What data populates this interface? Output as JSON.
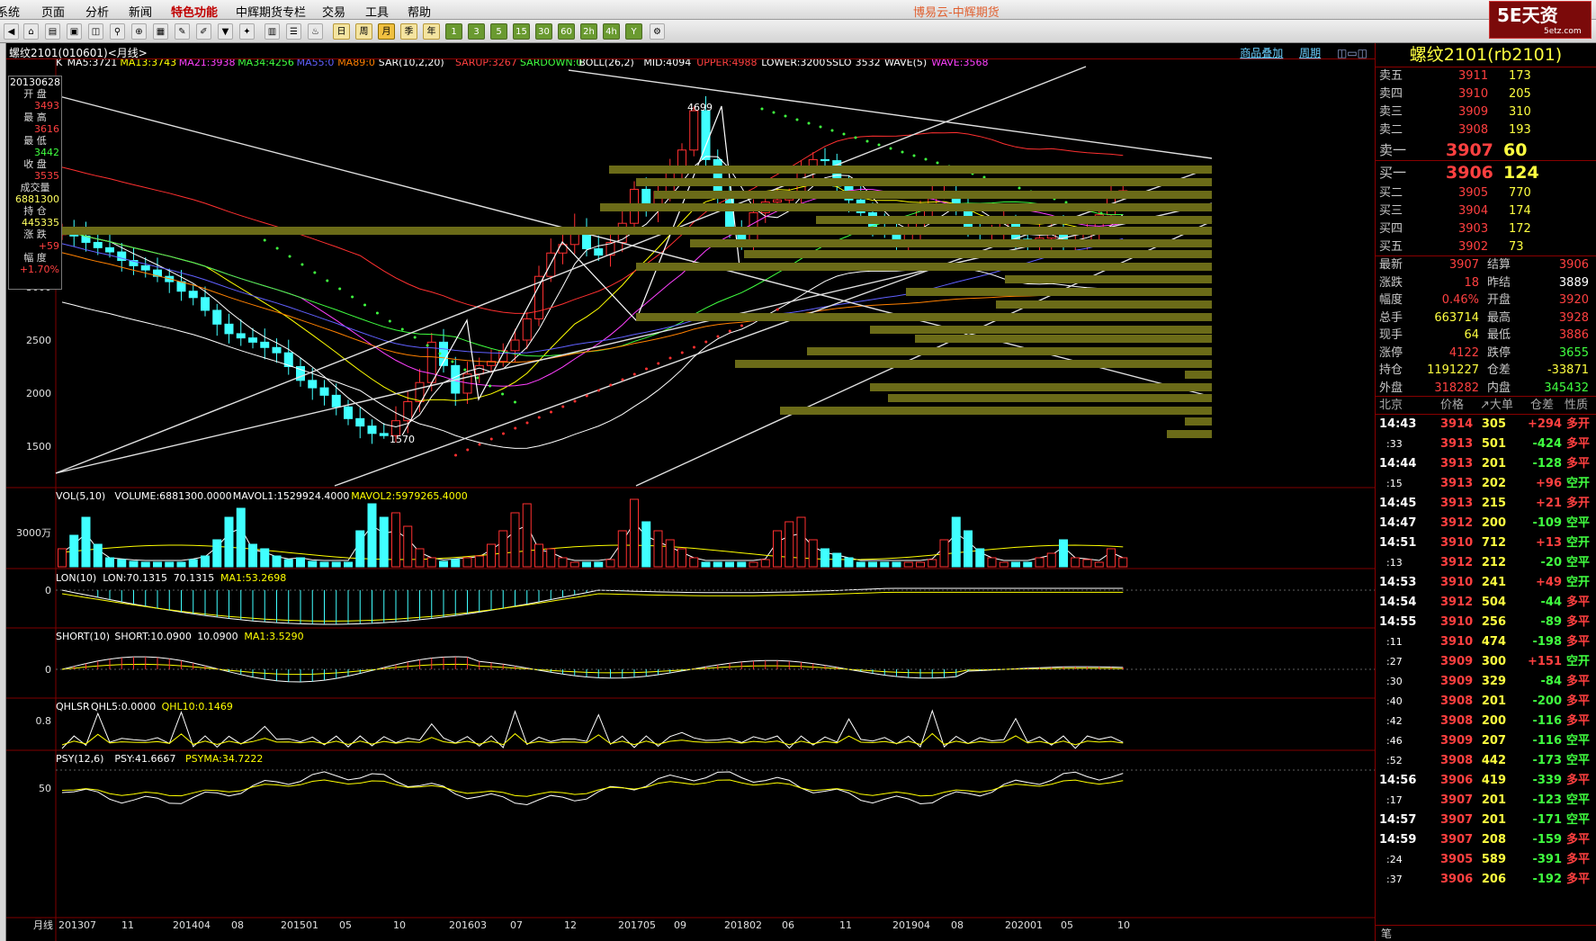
{
  "menu": {
    "items": [
      "系统",
      "页面",
      "分析",
      "新闻",
      "特色功能",
      "中辉期货专栏",
      "交易",
      "工具",
      "帮助"
    ],
    "app_title": "博易云-中辉期货"
  },
  "toolbar": {
    "period_buttons": [
      "日",
      "周",
      "月",
      "季",
      "年",
      "1",
      "3",
      "5",
      "15",
      "30",
      "60",
      "2h",
      "4h",
      "Y"
    ]
  },
  "logo": {
    "text": "5E天资",
    "url_text": "5etz.com"
  },
  "chart": {
    "title": "螺纹2101(010601)<月线>",
    "header_links": [
      "商品叠加",
      "周期"
    ],
    "main_legend": [
      {
        "text": "K",
        "color": "#ffffff"
      },
      {
        "text": "MA5:3721",
        "color": "#ffffff"
      },
      {
        "text": "MA13:3743",
        "color": "#ffff00"
      },
      {
        "text": "MA21:3938",
        "color": "#ff40ff"
      },
      {
        "text": "MA34:4256",
        "color": "#40ff40"
      },
      {
        "text": "MA55:0",
        "color": "#6060ff"
      },
      {
        "text": "MA89:0",
        "color": "#ff8000"
      },
      {
        "text": "SAR(10,2,20)",
        "color": "#ffffff"
      },
      {
        "text": "SARUP:3267",
        "color": "#ff4040"
      },
      {
        "text": "SARDOWN:0",
        "color": "#40ff40"
      },
      {
        "text": "BOLL(26,2)",
        "color": "#ffffff"
      },
      {
        "text": "MID:4094",
        "color": "#ffffff"
      },
      {
        "text": "UPPER:4988",
        "color": "#ff4040"
      },
      {
        "text": "LOWER:3200",
        "color": "#ffffff"
      },
      {
        "text": "SSLO",
        "color": "#ffffff"
      },
      {
        "text": "3532",
        "color": "#ffffff"
      },
      {
        "text": "WAVE(5)",
        "color": "#ffffff"
      },
      {
        "text": "WAVE:3568",
        "color": "#ff40ff"
      }
    ],
    "y_ticks": [
      "3000",
      "2500",
      "2000",
      "1500"
    ],
    "annotations": {
      "high": "4699",
      "low": "1570"
    },
    "infobox": {
      "date": "20130628",
      "open_label": "开 盘",
      "open": "3493",
      "high_label": "最 高",
      "high": "3616",
      "low_label": "最 低",
      "low": "3442",
      "close_label": "收 盘",
      "close": "3535",
      "vol_label": "成交量",
      "vol": "6881300",
      "oi_label": "持 仓",
      "oi": "445335",
      "chg_label": "涨 跌",
      "chg": "+59",
      "pct_label": "幅 度",
      "pct": "+1.70%"
    },
    "vol_legend": [
      {
        "text": "VOL(5,10)",
        "color": "#ffffff"
      },
      {
        "text": "VOLUME:6881300.0000",
        "color": "#ffffff"
      },
      {
        "text": "MAVOL1:1529924.4000",
        "color": "#ffffff"
      },
      {
        "text": "MAVOL2:5979265.4000",
        "color": "#ffff00"
      }
    ],
    "vol_tick": "3000万",
    "lon_legend": [
      {
        "text": "LON(10)",
        "color": "#ffffff"
      },
      {
        "text": "LON:70.1315",
        "color": "#ffffff"
      },
      {
        "text": "70.1315",
        "color": "#ffffff"
      },
      {
        "text": "MA1:53.2698",
        "color": "#ffff00"
      }
    ],
    "lon_tick": "0",
    "short_legend": [
      {
        "text": "SHORT(10)",
        "color": "#ffffff"
      },
      {
        "text": "SHORT:10.0900",
        "color": "#ffffff"
      },
      {
        "text": "10.0900",
        "color": "#ffffff"
      },
      {
        "text": "MA1:3.5290",
        "color": "#ffff00"
      }
    ],
    "short_tick": "0",
    "qhl_legend": [
      {
        "text": "QHLSR",
        "color": "#ffffff"
      },
      {
        "text": "QHL5:0.0000",
        "color": "#ffffff"
      },
      {
        "text": "QHL10:0.1469",
        "color": "#ffff00"
      }
    ],
    "qhl_tick": "0.8",
    "psy_legend": [
      {
        "text": "PSY(12,6)",
        "color": "#ffffff"
      },
      {
        "text": "PSY:41.6667",
        "color": "#ffffff"
      },
      {
        "text": "PSYMA:34.7222",
        "color": "#ffff00"
      }
    ],
    "psy_tick": "50",
    "x_axis_label": "月线",
    "x_ticks": [
      "201307",
      "11",
      "201404",
      "08",
      "201501",
      "05",
      "10",
      "201603",
      "07",
      "12",
      "201705",
      "09",
      "201802",
      "06",
      "11",
      "201904",
      "08",
      "202001",
      "05",
      "10"
    ]
  },
  "chart_data": {
    "type": "candlestick",
    "symbol": "螺纹2101",
    "period": "monthly",
    "y_ticks": [
      1500,
      2000,
      2500,
      3000
    ],
    "labeled_extremes": {
      "high": 4699,
      "low": 1570
    },
    "indicators": {
      "MA5": 3721,
      "MA13": 3743,
      "MA21": 3938,
      "MA34": 4256,
      "MA55": 0,
      "MA89": 0,
      "SARUP": 3267,
      "SARDOWN": 0,
      "MID": 4094,
      "UPPER": 4988,
      "LOWER": 3200,
      "SSLO": 3532,
      "WAVE": 3568
    },
    "volume": {
      "VOLUME": 6881300,
      "MAVOL1": 1529924.4,
      "MAVOL2": 5979265.4
    },
    "LON": 70.1315,
    "LON_MA1": 53.2698,
    "SHORT": 10.09,
    "SHORT_MA1": 3.529,
    "QHL5": 0,
    "QHL10": 0.1469,
    "PSY": 41.6667,
    "PSYMA": 34.7222
  },
  "quote": {
    "title": "螺纹2101(rb2101)",
    "asks": [
      {
        "label": "卖五",
        "price": "3911",
        "vol": "173"
      },
      {
        "label": "卖四",
        "price": "3910",
        "vol": "205"
      },
      {
        "label": "卖三",
        "price": "3909",
        "vol": "310"
      },
      {
        "label": "卖二",
        "price": "3908",
        "vol": "193"
      },
      {
        "label": "卖一",
        "price": "3907",
        "vol": "60"
      }
    ],
    "bids": [
      {
        "label": "买一",
        "price": "3906",
        "vol": "124"
      },
      {
        "label": "买二",
        "price": "3905",
        "vol": "770"
      },
      {
        "label": "买三",
        "price": "3904",
        "vol": "174"
      },
      {
        "label": "买四",
        "price": "3903",
        "vol": "172"
      },
      {
        "label": "买五",
        "price": "3902",
        "vol": "73"
      }
    ],
    "stats": [
      {
        "l1": "最新",
        "v1": "3907",
        "c1": "red",
        "l2": "结算",
        "v2": "3906",
        "c2": "red"
      },
      {
        "l1": "涨跌",
        "v1": "18",
        "c1": "red",
        "l2": "昨结",
        "v2": "3889",
        "c2": "wht"
      },
      {
        "l1": "幅度",
        "v1": "0.46%",
        "c1": "red",
        "l2": "开盘",
        "v2": "3920",
        "c2": "red"
      },
      {
        "l1": "总手",
        "v1": "663714",
        "c1": "yel",
        "l2": "最高",
        "v2": "3928",
        "c2": "red"
      },
      {
        "l1": "现手",
        "v1": "64",
        "c1": "yel",
        "l2": "最低",
        "v2": "3886",
        "c2": "red"
      },
      {
        "l1": "涨停",
        "v1": "4122",
        "c1": "red",
        "l2": "跌停",
        "v2": "3655",
        "c2": "grn"
      },
      {
        "l1": "持仓",
        "v1": "1191227",
        "c1": "yel",
        "l2": "仓差",
        "v2": "-33871",
        "c2": "yel"
      },
      {
        "l1": "外盘",
        "v1": "318282",
        "c1": "red",
        "l2": "内盘",
        "v2": "345432",
        "c2": "grn"
      }
    ],
    "tick_header": {
      "place": "北京",
      "price": "价格",
      "vol": "↗大单",
      "oi": "仓差",
      "nature": "性质"
    },
    "ticks": [
      {
        "time": "14:43",
        "price": "3914",
        "vol": "305",
        "oi": "+294",
        "nature": "多开",
        "tc": "wht"
      },
      {
        "time": ":33",
        "price": "3913",
        "vol": "501",
        "oi": "-424",
        "nature": "多平",
        "tc": "wht"
      },
      {
        "time": "14:44",
        "price": "3913",
        "vol": "201",
        "oi": "-128",
        "nature": "多平",
        "tc": "wht"
      },
      {
        "time": ":15",
        "price": "3913",
        "vol": "202",
        "oi": "+96",
        "nature": "空开",
        "tc": "wht"
      },
      {
        "time": "14:45",
        "price": "3913",
        "vol": "215",
        "oi": "+21",
        "nature": "多开",
        "tc": "wht"
      },
      {
        "time": "14:47",
        "price": "3912",
        "vol": "200",
        "oi": "-109",
        "nature": "空平",
        "tc": "wht"
      },
      {
        "time": "14:51",
        "price": "3910",
        "vol": "712",
        "oi": "+13",
        "nature": "空开",
        "tc": "wht"
      },
      {
        "time": ":13",
        "price": "3912",
        "vol": "212",
        "oi": "-20",
        "nature": "空平",
        "tc": "wht"
      },
      {
        "time": "14:53",
        "price": "3910",
        "vol": "241",
        "oi": "+49",
        "nature": "空开",
        "tc": "wht"
      },
      {
        "time": "14:54",
        "price": "3912",
        "vol": "504",
        "oi": "-44",
        "nature": "多平",
        "tc": "wht"
      },
      {
        "time": "14:55",
        "price": "3910",
        "vol": "256",
        "oi": "-89",
        "nature": "多平",
        "tc": "wht"
      },
      {
        "time": ":11",
        "price": "3910",
        "vol": "474",
        "oi": "-198",
        "nature": "多平",
        "tc": "wht"
      },
      {
        "time": ":27",
        "price": "3909",
        "vol": "300",
        "oi": "+151",
        "nature": "空开",
        "tc": "wht"
      },
      {
        "time": ":30",
        "price": "3909",
        "vol": "329",
        "oi": "-84",
        "nature": "多平",
        "tc": "wht"
      },
      {
        "time": ":40",
        "price": "3908",
        "vol": "201",
        "oi": "-200",
        "nature": "多平",
        "tc": "wht"
      },
      {
        "time": ":42",
        "price": "3908",
        "vol": "200",
        "oi": "-116",
        "nature": "多平",
        "tc": "wht"
      },
      {
        "time": ":46",
        "price": "3909",
        "vol": "207",
        "oi": "-116",
        "nature": "空平",
        "tc": "wht"
      },
      {
        "time": ":52",
        "price": "3908",
        "vol": "442",
        "oi": "-173",
        "nature": "空平",
        "tc": "wht"
      },
      {
        "time": "14:56",
        "price": "3906",
        "vol": "419",
        "oi": "-339",
        "nature": "多平",
        "tc": "wht"
      },
      {
        "time": ":17",
        "price": "3907",
        "vol": "201",
        "oi": "-123",
        "nature": "空平",
        "tc": "wht"
      },
      {
        "time": "14:57",
        "price": "3907",
        "vol": "201",
        "oi": "-171",
        "nature": "空平",
        "tc": "wht"
      },
      {
        "time": "14:59",
        "price": "3907",
        "vol": "208",
        "oi": "-159",
        "nature": "多平",
        "tc": "wht"
      },
      {
        "time": ":24",
        "price": "3905",
        "vol": "589",
        "oi": "-391",
        "nature": "多平",
        "tc": "wht"
      },
      {
        "time": ":37",
        "price": "3906",
        "vol": "206",
        "oi": "-192",
        "nature": "多平",
        "tc": "wht"
      }
    ],
    "footer": "笔"
  }
}
